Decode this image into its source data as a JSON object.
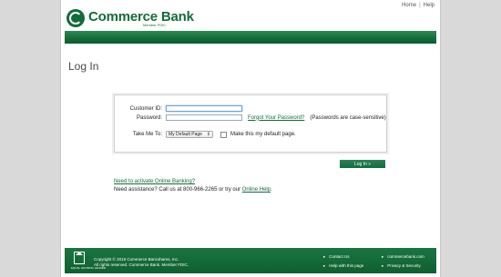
{
  "header": {
    "links": {
      "home": "Home",
      "separator": "|",
      "help": "Help"
    },
    "logo": {
      "name": "Commerce Bank",
      "tagline": "Member FDIC"
    }
  },
  "page": {
    "title": "Log In"
  },
  "form": {
    "customer_id_label": "Customer ID:",
    "password_label": "Password:",
    "forgot_password": "Forgot Your Password?",
    "case_note": "(Passwords are case-sensitive)",
    "take_me_to_label": "Take Me To:",
    "take_me_to_value": "My Default Page",
    "default_checkbox_label": "Make this my default page.",
    "login_button": "Log In »"
  },
  "help": {
    "activate_link": "Need to activate Online Banking?",
    "assistance_text": "Need assistance? Call us at 800-966-2265 or try our",
    "online_help": "Online Help",
    "period": "."
  },
  "footer": {
    "ehl_label": "EQUAL HOUSING LENDER",
    "copyright": "Copyright © 2015 Commerce Bancshares, Inc.",
    "rights": "All rights reserved. Commerce Bank. Member FDIC.",
    "links_col1": [
      "Contact Us",
      "Help with this page"
    ],
    "links_col2": [
      "commercebank.com",
      "Privacy & Security"
    ]
  },
  "colors": {
    "brand_green": "#146b3a",
    "page_bg": "#d9d9d9"
  }
}
